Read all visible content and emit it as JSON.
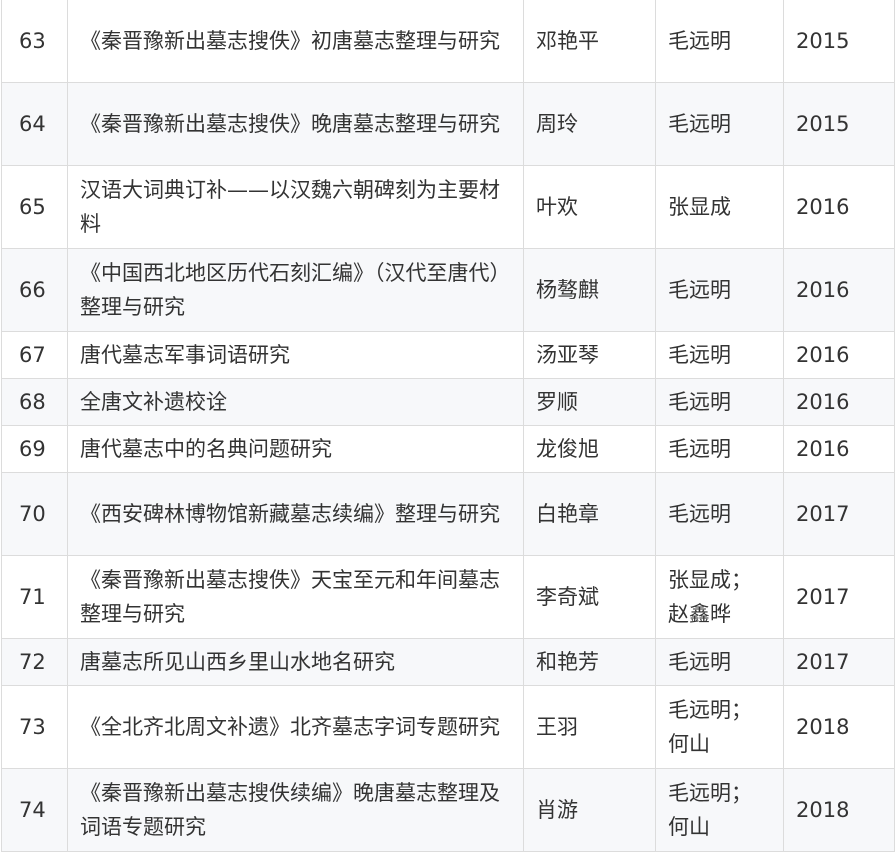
{
  "rows": [
    {
      "no": "63",
      "title": "《秦晋豫新出墓志搜佚》初唐墓志整理与研究",
      "author": "邓艳平",
      "advisor": "毛远明",
      "year": "2015"
    },
    {
      "no": "64",
      "title": "《秦晋豫新出墓志搜佚》晚唐墓志整理与研究",
      "author": "周玲",
      "advisor": "毛远明",
      "year": "2015"
    },
    {
      "no": "65",
      "title": "汉语大词典订补——以汉魏六朝碑刻为主要材料",
      "author": "叶欢",
      "advisor": "张显成",
      "year": "2016"
    },
    {
      "no": "66",
      "title": "《中国西北地区历代石刻汇编》（汉代至唐代）整理与研究",
      "author": "杨骜麒",
      "advisor": "毛远明",
      "year": "2016"
    },
    {
      "no": "67",
      "title": "唐代墓志军事词语研究",
      "author": "汤亚琴",
      "advisor": "毛远明",
      "year": "2016"
    },
    {
      "no": "68",
      "title": "全唐文补遗校诠",
      "author": "罗顺",
      "advisor": "毛远明",
      "year": "2016"
    },
    {
      "no": "69",
      "title": "唐代墓志中的名典问题研究",
      "author": "龙俊旭",
      "advisor": "毛远明",
      "year": "2016"
    },
    {
      "no": "70",
      "title": "《西安碑林博物馆新藏墓志续编》整理与研究",
      "author": "白艳章",
      "advisor": "毛远明",
      "year": "2017"
    },
    {
      "no": "71",
      "title": "《秦晋豫新出墓志搜佚》天宝至元和年间墓志整理与研究",
      "author": "李奇斌",
      "advisor": "张显成；赵鑫晔",
      "year": "2017"
    },
    {
      "no": "72",
      "title": "唐墓志所见山西乡里山水地名研究",
      "author": "和艳芳",
      "advisor": "毛远明",
      "year": "2017"
    },
    {
      "no": "73",
      "title": "《全北齐北周文补遗》北齐墓志字词专题研究",
      "author": "王羽",
      "advisor": "毛远明；何山",
      "year": "2018"
    },
    {
      "no": "74",
      "title": "《秦晋豫新出墓志搜佚续编》晚唐墓志整理及词语专题研究",
      "author": "肖游",
      "advisor": "毛远明；何山",
      "year": "2018"
    }
  ]
}
